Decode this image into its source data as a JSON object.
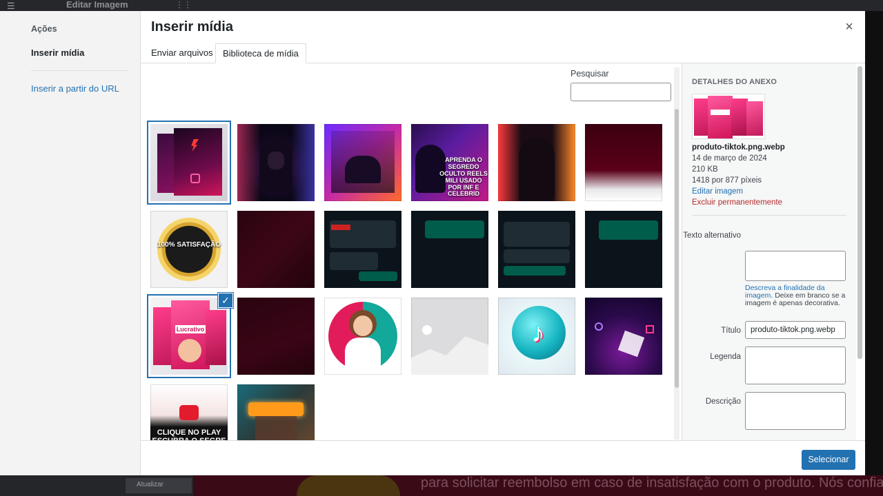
{
  "background": {
    "editor_title": "Editar Imagem",
    "bottom_text": "para solicitar reembolso em caso de insatisfação com o produto. Nós confiamos tanto em nossos estudos e",
    "update_label": "Atualizar"
  },
  "modal": {
    "title": "Inserir mídia",
    "menu": {
      "heading": "Ações",
      "items": [
        "Inserir mídia",
        "Inserir a partir do URL"
      ]
    },
    "tabs": [
      "Enviar arquivos",
      "Biblioteca de mídia"
    ],
    "search": {
      "label": "Pesquisar",
      "value": ""
    },
    "thumbnails": [
      {
        "name": "thumb-product-box-dark",
        "selected": true,
        "checked": false
      },
      {
        "name": "thumb-hooded-hacker-1",
        "selected": false,
        "checked": false
      },
      {
        "name": "thumb-hacker-laptop",
        "selected": false,
        "checked": false
      },
      {
        "name": "thumb-reels-milionarios",
        "selected": false,
        "checked": false,
        "caption": "APRENDA O SEGREDO OCULTO REELS MILI USADO POR INF E CELEBRID"
      },
      {
        "name": "thumb-hooded-hacker-2",
        "selected": false,
        "checked": false
      },
      {
        "name": "thumb-dark-red-gradient",
        "selected": false,
        "checked": false
      },
      {
        "name": "thumb-satisfaction-badge",
        "selected": false,
        "checked": false,
        "caption": "100% SATISFAÇÃO"
      },
      {
        "name": "thumb-dark-red-texture",
        "selected": false,
        "checked": false
      },
      {
        "name": "thumb-chat-screenshot-1",
        "selected": false,
        "checked": false
      },
      {
        "name": "thumb-chat-screenshot-2",
        "selected": false,
        "checked": false
      },
      {
        "name": "thumb-chat-screenshot-3",
        "selected": false,
        "checked": false
      },
      {
        "name": "thumb-chat-screenshot-4",
        "selected": false,
        "checked": false
      },
      {
        "name": "thumb-produto-tiktok",
        "selected": true,
        "checked": true
      },
      {
        "name": "thumb-dark-red-plain",
        "selected": false,
        "checked": false
      },
      {
        "name": "thumb-woman-phone",
        "selected": false,
        "checked": false
      },
      {
        "name": "thumb-placeholder-image",
        "selected": false,
        "checked": false
      },
      {
        "name": "thumb-tiktok-logo-3d",
        "selected": false,
        "checked": false
      },
      {
        "name": "thumb-neon-tiktok-shapes",
        "selected": false,
        "checked": false
      },
      {
        "name": "thumb-clique-no-play",
        "selected": false,
        "checked": false,
        "caption": "CLIQUE NO PLAY ESCUBRA O SEGRE"
      },
      {
        "name": "thumb-neon-glasses-man",
        "selected": false,
        "checked": false
      }
    ],
    "details": {
      "heading": "DETALHES DO ANEXO",
      "filename": "produto-tiktok.png.webp",
      "date": "14 de março de 2024",
      "size": "210 KB",
      "dimensions": "1418 por 877 píxeis",
      "edit_link": "Editar imagem",
      "delete_link": "Excluir permanentemente",
      "fields": {
        "alt_label": "Texto alternativo",
        "alt_value": "",
        "alt_help_link": "Descreva a finalidade da imagem",
        "alt_help_text": ". Deixe em branco se a imagem é apenas decorativa.",
        "title_label": "Título",
        "title_value": "produto-tiktok.png.webp",
        "caption_label": "Legenda",
        "caption_value": "",
        "description_label": "Descrição",
        "description_value": ""
      }
    },
    "select_button": "Selecionar",
    "close_glyph": "×",
    "check_glyph": "✓"
  },
  "colors": {
    "accent": "#2271b1",
    "danger": "#b32d2e",
    "menu_bg": "#f3f3f3",
    "sidebar_bg": "#f6f7f7"
  }
}
